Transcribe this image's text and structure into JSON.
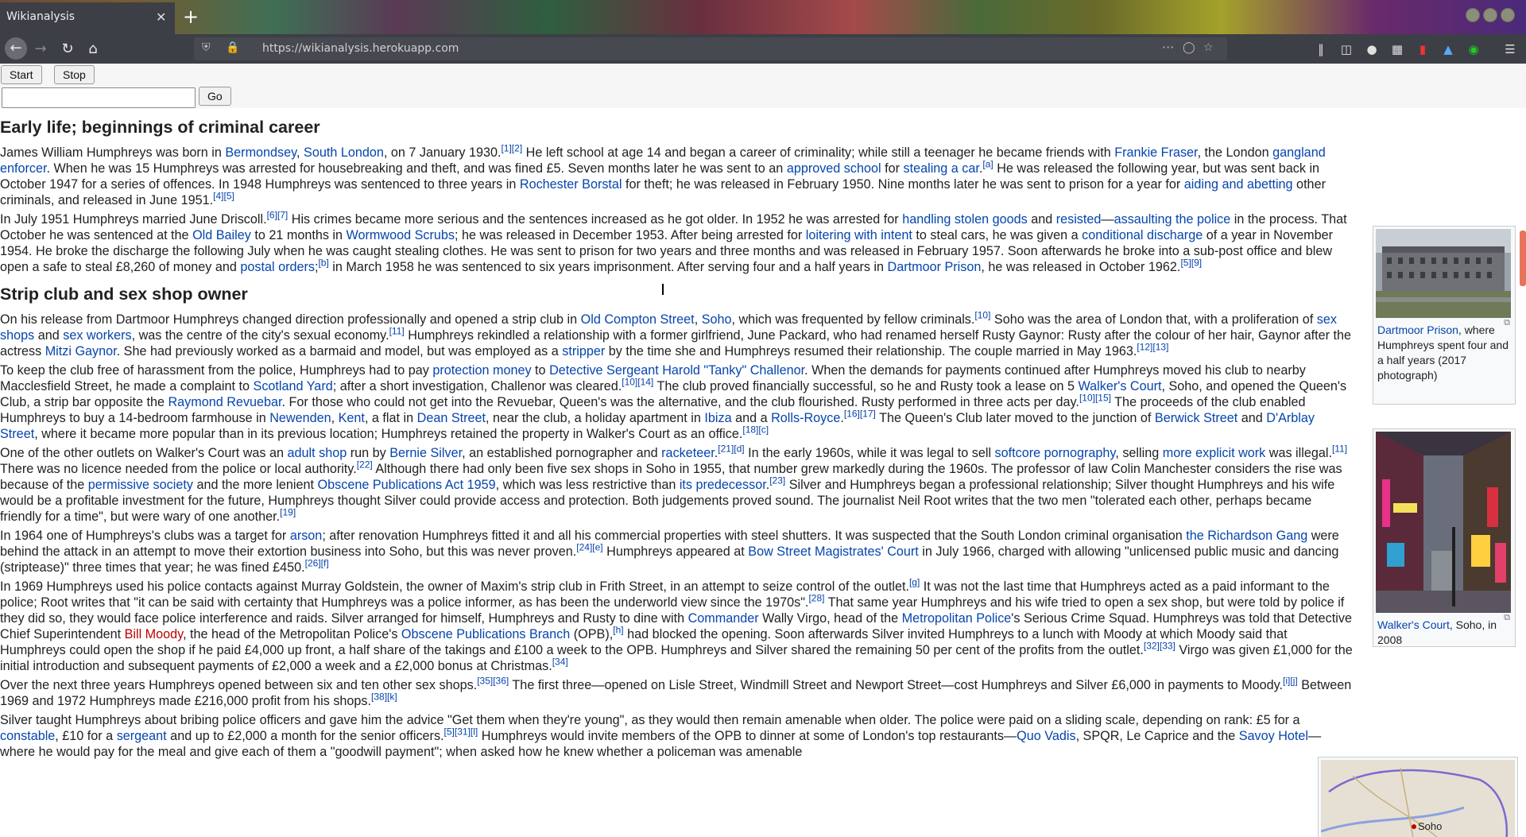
{
  "browser": {
    "tab_title": "Wikianalysis",
    "tab_close": "✕",
    "new_tab": "+",
    "url": "https://wikianalysis.herokuapp.com",
    "page_actions": "···"
  },
  "controls": {
    "start_label": "Start",
    "stop_label": "Stop",
    "input_value": "",
    "go_label": "Go"
  },
  "article": {
    "h_early": "Early life; beginnings of criminal career",
    "h_strip": "Strip club and sex shop owner"
  },
  "images": {
    "dartmoor": {
      "link": "Dartmoor Prison",
      "caption": ", where Humphreys spent four and a half years (2017 photograph)"
    },
    "walkers": {
      "link": "Walker's Court",
      "caption": ", Soho, in 2008"
    },
    "map": {
      "label": "Soho"
    }
  },
  "colors": {
    "link": "#0645ad",
    "redlink": "#ba0000",
    "text": "#202122"
  }
}
